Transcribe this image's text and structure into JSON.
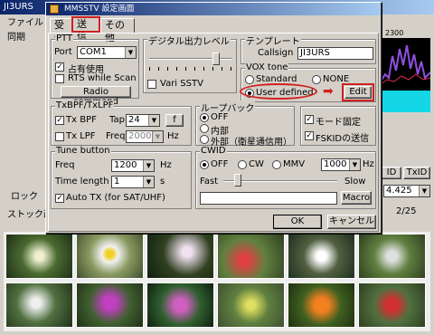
{
  "background_window": {
    "title": "JI3URS",
    "menu": [
      "ファイル"
    ],
    "left_labels": [
      "同期",
      "ロック",
      "ストック画"
    ],
    "freq_display": "2300",
    "right_buttons": [
      "ID",
      "TxID"
    ],
    "right_value": "4.425",
    "right_page": "2/25"
  },
  "dialog": {
    "title": "MMSSTV 設定画面",
    "tabs": [
      "受信",
      "送信",
      "その他"
    ],
    "active_tab": "送信",
    "ptt": {
      "title": "PTT",
      "port_label": "Port",
      "port_value": "COM1",
      "exclusive_label": "占有使用",
      "rts_label": "RTS while Scan",
      "radio_command_label": "Radio command"
    },
    "digital_level": {
      "title": "デジタル出力レベル",
      "vari_sstv_label": "Vari SSTV"
    },
    "template": {
      "title": "テンプレート",
      "callsign_label": "Callsign",
      "callsign_value": "JI3URS"
    },
    "vox": {
      "title": "VOX tone",
      "standard_label": "Standard",
      "none_label": "NONE",
      "user_defined_label": "User defined",
      "edit_label": "Edit"
    },
    "bpf": {
      "title": "TxBPF/TxLPF",
      "txbpf_label": "Tx BPF",
      "tap_label": "Tap",
      "tap_value": "24",
      "f_label": "f",
      "txlpf_label": "Tx LPF",
      "freq_label": "Freq",
      "freq_value": "2000",
      "hz_label": "Hz"
    },
    "loopback": {
      "title": "ループバック",
      "off_label": "OFF",
      "internal_label": "内部",
      "external_label": "外部（衛星通信用）"
    },
    "fixed_mode_label": "モード固定",
    "fskid_label": "FSKIDの送信",
    "tune": {
      "title": "Tune button",
      "freq_label": "Freq",
      "freq_value": "1200",
      "hz_label": "Hz",
      "length_label": "Time length",
      "length_value": "1",
      "sec_label": "s",
      "auto_tx_label": "Auto TX (for SAT/UHF)"
    },
    "cwid": {
      "title": "CWID",
      "off_label": "OFF",
      "cw_label": "CW",
      "mmv_label": "MMV",
      "freq_value": "1000",
      "hz_label": "Hz",
      "fast_label": "Fast",
      "slow_label": "Slow",
      "macro_label": "Macro"
    },
    "ok_label": "OK",
    "cancel_label": "キャンセル"
  }
}
